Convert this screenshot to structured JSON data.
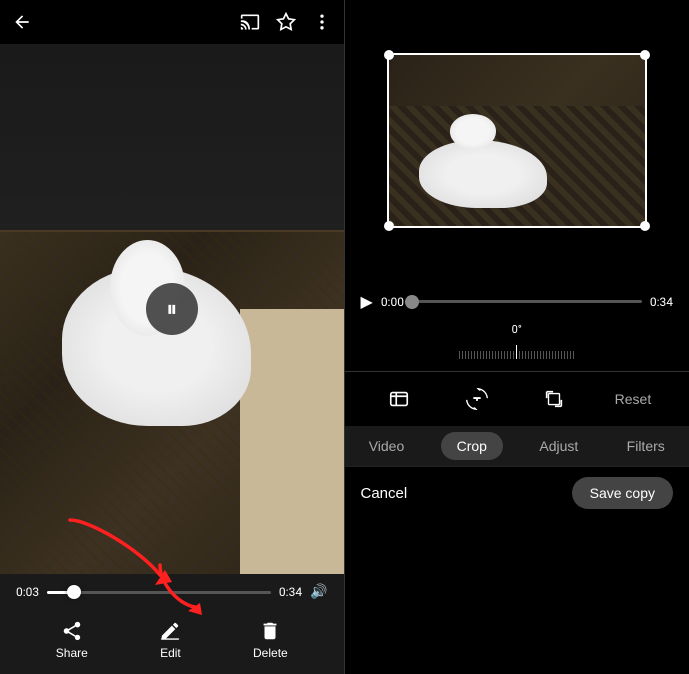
{
  "left": {
    "top_bar": {
      "back_icon": "←",
      "cast_icon": "⬜",
      "star_icon": "☆",
      "more_icon": "⋮"
    },
    "timeline": {
      "start_time": "0:03",
      "end_time": "0:34",
      "thumb_position": "12%"
    },
    "actions": [
      {
        "id": "share",
        "label": "Share",
        "icon": "share"
      },
      {
        "id": "edit",
        "label": "Edit",
        "icon": "edit"
      },
      {
        "id": "delete",
        "label": "Delete",
        "icon": "delete"
      }
    ]
  },
  "right": {
    "playback": {
      "play_icon": "▶",
      "start_time": "0:00",
      "end_time": "0:34"
    },
    "rotation": {
      "degrees": "0°"
    },
    "tools": {
      "reset_label": "Reset"
    },
    "tabs": [
      {
        "id": "video",
        "label": "Video",
        "active": false
      },
      {
        "id": "crop",
        "label": "Crop",
        "active": true
      },
      {
        "id": "adjust",
        "label": "Adjust",
        "active": false
      },
      {
        "id": "filters",
        "label": "Filters",
        "active": false
      }
    ],
    "bottom": {
      "cancel_label": "Cancel",
      "save_label": "Save copy"
    }
  }
}
